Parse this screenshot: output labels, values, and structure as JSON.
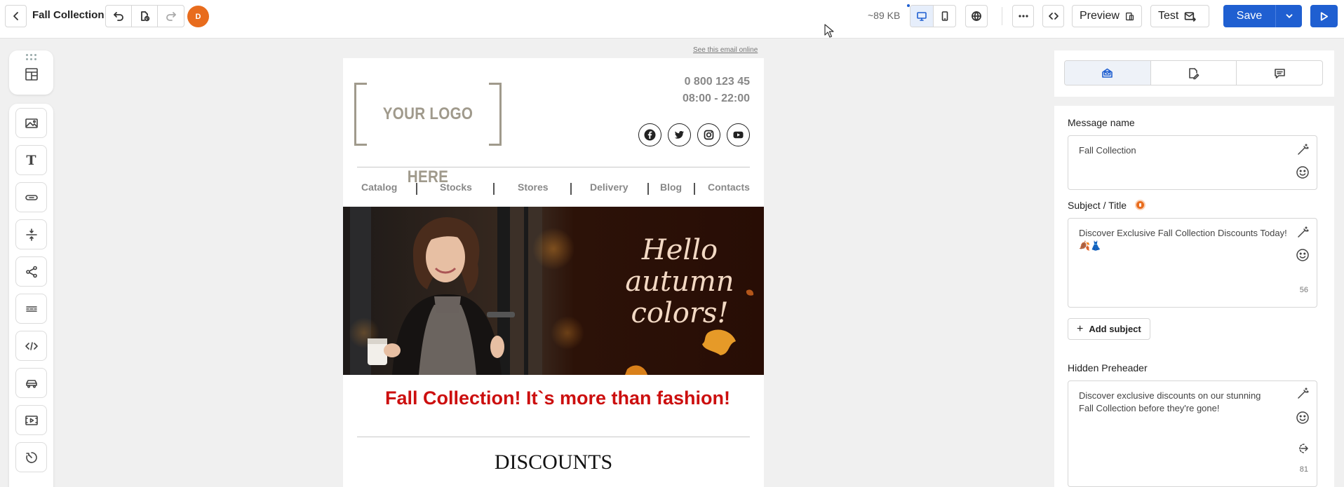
{
  "header": {
    "document_title": "Fall Collection",
    "avatar_initial": "D",
    "email_size": "~89 KB",
    "preview_label": "Preview",
    "test_label": "Test",
    "save_label": "Save"
  },
  "email": {
    "see_online_link": "See this email online",
    "logo_text": "YOUR LOGO HERE",
    "phone": "0 800 123 45",
    "hours": "08:00 - 22:00",
    "socials": [
      "facebook-icon",
      "twitter-icon",
      "instagram-icon",
      "youtube-icon"
    ],
    "nav": [
      "Catalog",
      "Stocks",
      "Stores",
      "Delivery",
      "Blog",
      "Contacts"
    ],
    "hero_text": [
      "Hello",
      "autumn",
      "colors!"
    ],
    "headline": "Fall Collection! It`s more than fashion!",
    "discounts_heading": "DISCOUNTS"
  },
  "panel": {
    "message_name_label": "Message name",
    "message_name_value": "Fall Collection",
    "subject_label": "Subject / Title",
    "subject_value": "Discover Exclusive Fall Collection Discounts Today! 🍂👗",
    "subject_count": "56",
    "add_subject_label": "Add subject",
    "preheader_label": "Hidden Preheader",
    "preheader_value": "Discover exclusive discounts on our stunning Fall Collection before they're gone!",
    "preheader_count": "81"
  },
  "colors": {
    "accent": "#1f5fd1",
    "avatar": "#e86c1d",
    "headline": "#cc0f0f",
    "hero_background": "#2a1007"
  }
}
